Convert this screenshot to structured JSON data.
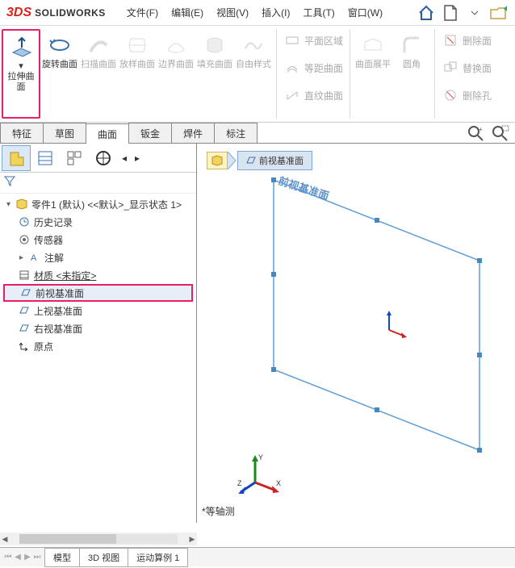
{
  "app": {
    "logo_s": "3DS",
    "logo_text": "SOLIDWORKS"
  },
  "menu": {
    "file": "文件(F)",
    "edit": "编辑(E)",
    "view": "视图(V)",
    "insert": "插入(I)",
    "tools": "工具(T)",
    "window": "窗口(W)"
  },
  "ribbon": {
    "extrude": "拉伸曲面",
    "revolve": "旋转曲面",
    "sweep": "扫描曲面",
    "loft": "放样曲面",
    "boundary": "边界曲面",
    "fill": "填充曲面",
    "freeform": "自由样式",
    "planar": "平面区域",
    "offset": "等距曲面",
    "ruled": "直纹曲面",
    "flatten": "曲面展平",
    "fillet": "圆角",
    "delete_face": "删除面",
    "replace_face": "替换面",
    "delete_hole": "删除孔"
  },
  "feature_tabs": {
    "features": "特征",
    "sketch": "草图",
    "surfaces": "曲面",
    "sheetmetal": "钣金",
    "weldments": "焊件",
    "annotate": "标注"
  },
  "tree": {
    "root": "零件1 (默认) <<默认>_显示状态 1>",
    "history": "历史记录",
    "sensors": "传感器",
    "annotations": "注解",
    "material": "材质 <未指定>",
    "front_plane": "前视基准面",
    "top_plane": "上视基准面",
    "right_plane": "右视基准面",
    "origin": "原点"
  },
  "viewport": {
    "breadcrumb": "前视基准面",
    "plane_label": "前视基准面",
    "orientation": "*等轴测"
  },
  "bottom_tabs": {
    "model": "模型",
    "view3d": "3D 视图",
    "motion": "运动算例 1"
  }
}
